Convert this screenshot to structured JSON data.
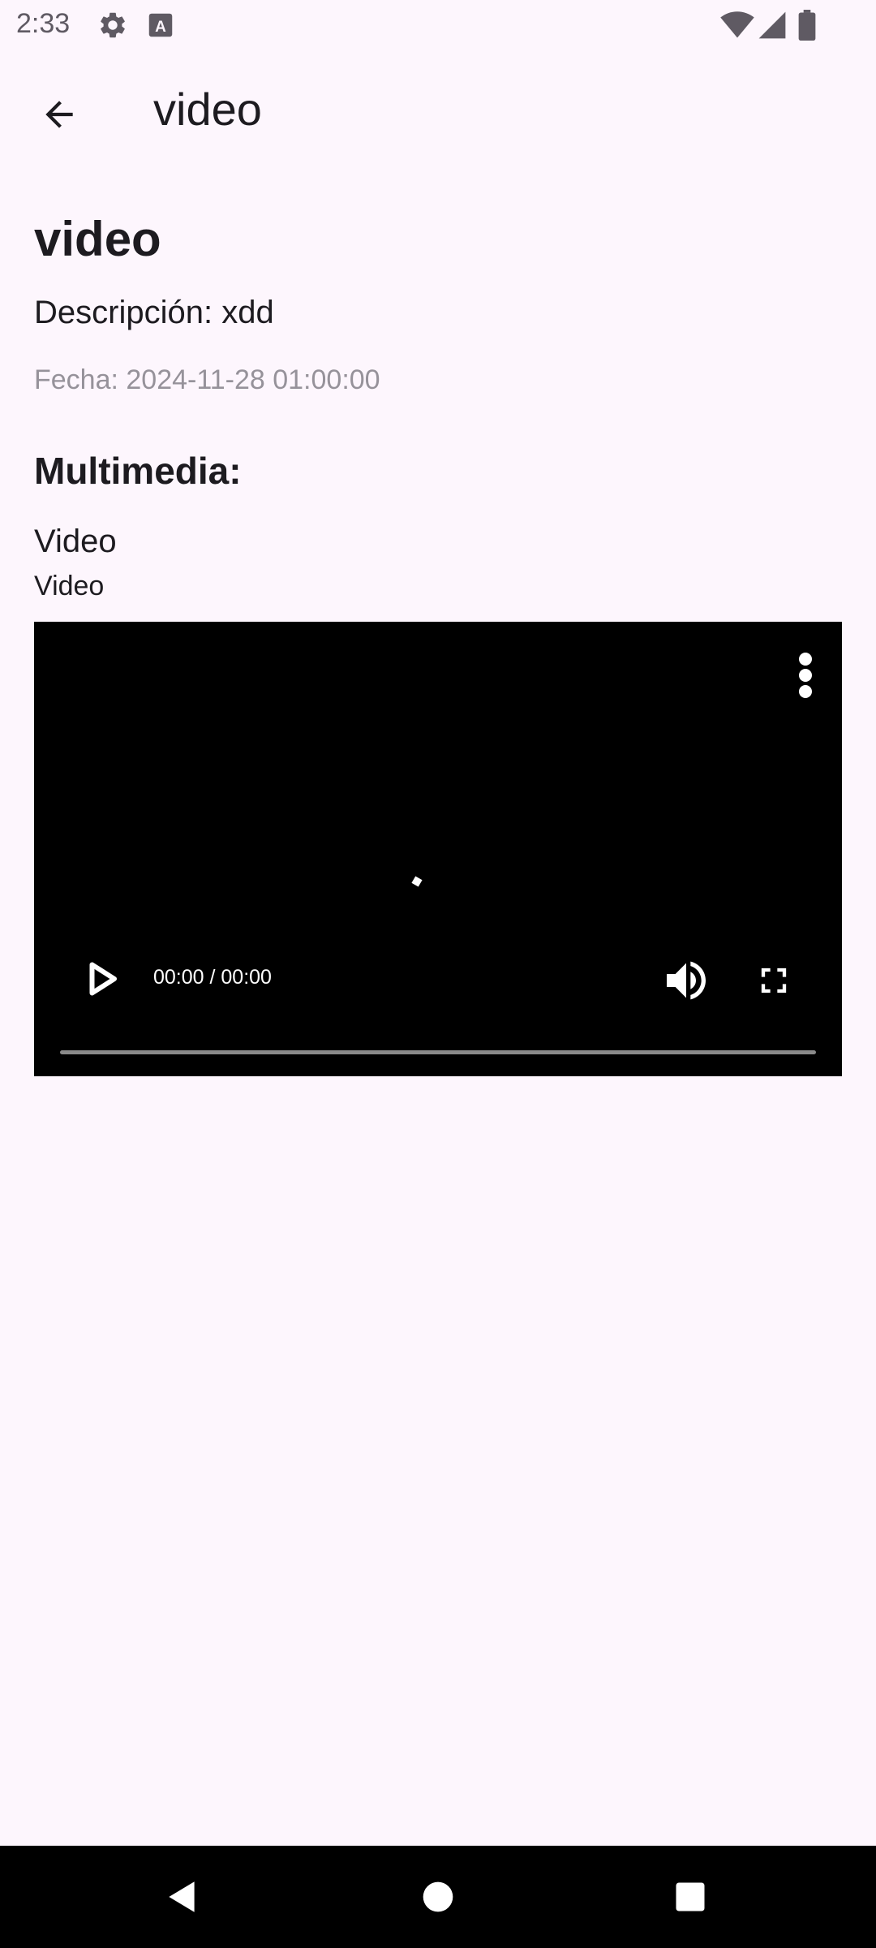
{
  "status_bar": {
    "time": "2:33",
    "icons": [
      "settings-icon",
      "keyboard-a-icon",
      "wifi-icon",
      "signal-icon",
      "battery-icon"
    ]
  },
  "app_bar": {
    "title": "video",
    "back_icon": "arrow-back-icon"
  },
  "post": {
    "title": "video",
    "description": "Descripción: xdd",
    "date": "Fecha: 2024-11-28 01:00:00"
  },
  "multimedia": {
    "section_title": "Multimedia:",
    "type_label": "Video",
    "caption": "Video"
  },
  "video_player": {
    "time": "00:00 / 00:00",
    "progress": 0,
    "controls": [
      "play-icon",
      "volume-icon",
      "fullscreen-icon",
      "more-vert-icon"
    ]
  },
  "nav_bar": {
    "buttons": [
      "back-triangle-icon",
      "home-circle-icon",
      "recents-square-icon"
    ]
  }
}
